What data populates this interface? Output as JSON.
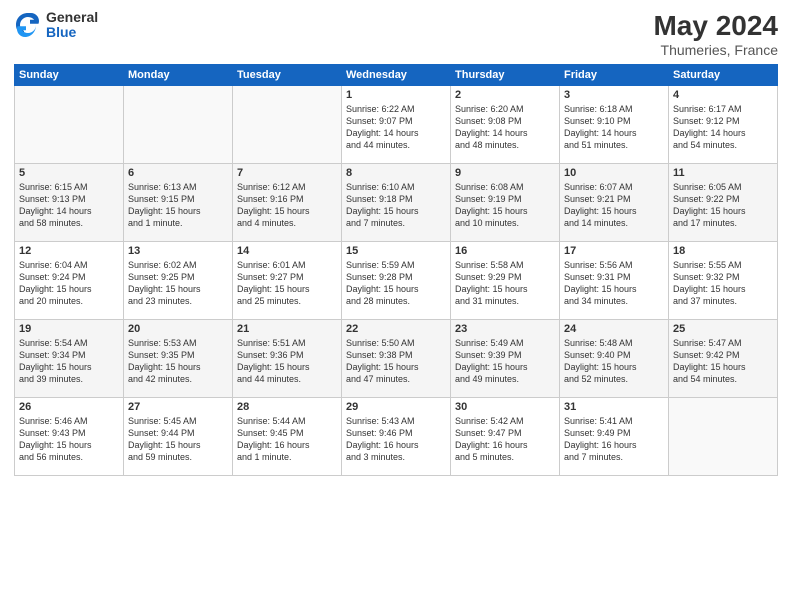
{
  "header": {
    "logo_general": "General",
    "logo_blue": "Blue",
    "month_year": "May 2024",
    "location": "Thumeries, France"
  },
  "weekdays": [
    "Sunday",
    "Monday",
    "Tuesday",
    "Wednesday",
    "Thursday",
    "Friday",
    "Saturday"
  ],
  "weeks": [
    [
      {
        "day": "",
        "info": ""
      },
      {
        "day": "",
        "info": ""
      },
      {
        "day": "",
        "info": ""
      },
      {
        "day": "1",
        "info": "Sunrise: 6:22 AM\nSunset: 9:07 PM\nDaylight: 14 hours\nand 44 minutes."
      },
      {
        "day": "2",
        "info": "Sunrise: 6:20 AM\nSunset: 9:08 PM\nDaylight: 14 hours\nand 48 minutes."
      },
      {
        "day": "3",
        "info": "Sunrise: 6:18 AM\nSunset: 9:10 PM\nDaylight: 14 hours\nand 51 minutes."
      },
      {
        "day": "4",
        "info": "Sunrise: 6:17 AM\nSunset: 9:12 PM\nDaylight: 14 hours\nand 54 minutes."
      }
    ],
    [
      {
        "day": "5",
        "info": "Sunrise: 6:15 AM\nSunset: 9:13 PM\nDaylight: 14 hours\nand 58 minutes."
      },
      {
        "day": "6",
        "info": "Sunrise: 6:13 AM\nSunset: 9:15 PM\nDaylight: 15 hours\nand 1 minute."
      },
      {
        "day": "7",
        "info": "Sunrise: 6:12 AM\nSunset: 9:16 PM\nDaylight: 15 hours\nand 4 minutes."
      },
      {
        "day": "8",
        "info": "Sunrise: 6:10 AM\nSunset: 9:18 PM\nDaylight: 15 hours\nand 7 minutes."
      },
      {
        "day": "9",
        "info": "Sunrise: 6:08 AM\nSunset: 9:19 PM\nDaylight: 15 hours\nand 10 minutes."
      },
      {
        "day": "10",
        "info": "Sunrise: 6:07 AM\nSunset: 9:21 PM\nDaylight: 15 hours\nand 14 minutes."
      },
      {
        "day": "11",
        "info": "Sunrise: 6:05 AM\nSunset: 9:22 PM\nDaylight: 15 hours\nand 17 minutes."
      }
    ],
    [
      {
        "day": "12",
        "info": "Sunrise: 6:04 AM\nSunset: 9:24 PM\nDaylight: 15 hours\nand 20 minutes."
      },
      {
        "day": "13",
        "info": "Sunrise: 6:02 AM\nSunset: 9:25 PM\nDaylight: 15 hours\nand 23 minutes."
      },
      {
        "day": "14",
        "info": "Sunrise: 6:01 AM\nSunset: 9:27 PM\nDaylight: 15 hours\nand 25 minutes."
      },
      {
        "day": "15",
        "info": "Sunrise: 5:59 AM\nSunset: 9:28 PM\nDaylight: 15 hours\nand 28 minutes."
      },
      {
        "day": "16",
        "info": "Sunrise: 5:58 AM\nSunset: 9:29 PM\nDaylight: 15 hours\nand 31 minutes."
      },
      {
        "day": "17",
        "info": "Sunrise: 5:56 AM\nSunset: 9:31 PM\nDaylight: 15 hours\nand 34 minutes."
      },
      {
        "day": "18",
        "info": "Sunrise: 5:55 AM\nSunset: 9:32 PM\nDaylight: 15 hours\nand 37 minutes."
      }
    ],
    [
      {
        "day": "19",
        "info": "Sunrise: 5:54 AM\nSunset: 9:34 PM\nDaylight: 15 hours\nand 39 minutes."
      },
      {
        "day": "20",
        "info": "Sunrise: 5:53 AM\nSunset: 9:35 PM\nDaylight: 15 hours\nand 42 minutes."
      },
      {
        "day": "21",
        "info": "Sunrise: 5:51 AM\nSunset: 9:36 PM\nDaylight: 15 hours\nand 44 minutes."
      },
      {
        "day": "22",
        "info": "Sunrise: 5:50 AM\nSunset: 9:38 PM\nDaylight: 15 hours\nand 47 minutes."
      },
      {
        "day": "23",
        "info": "Sunrise: 5:49 AM\nSunset: 9:39 PM\nDaylight: 15 hours\nand 49 minutes."
      },
      {
        "day": "24",
        "info": "Sunrise: 5:48 AM\nSunset: 9:40 PM\nDaylight: 15 hours\nand 52 minutes."
      },
      {
        "day": "25",
        "info": "Sunrise: 5:47 AM\nSunset: 9:42 PM\nDaylight: 15 hours\nand 54 minutes."
      }
    ],
    [
      {
        "day": "26",
        "info": "Sunrise: 5:46 AM\nSunset: 9:43 PM\nDaylight: 15 hours\nand 56 minutes."
      },
      {
        "day": "27",
        "info": "Sunrise: 5:45 AM\nSunset: 9:44 PM\nDaylight: 15 hours\nand 59 minutes."
      },
      {
        "day": "28",
        "info": "Sunrise: 5:44 AM\nSunset: 9:45 PM\nDaylight: 16 hours\nand 1 minute."
      },
      {
        "day": "29",
        "info": "Sunrise: 5:43 AM\nSunset: 9:46 PM\nDaylight: 16 hours\nand 3 minutes."
      },
      {
        "day": "30",
        "info": "Sunrise: 5:42 AM\nSunset: 9:47 PM\nDaylight: 16 hours\nand 5 minutes."
      },
      {
        "day": "31",
        "info": "Sunrise: 5:41 AM\nSunset: 9:49 PM\nDaylight: 16 hours\nand 7 minutes."
      },
      {
        "day": "",
        "info": ""
      }
    ]
  ]
}
